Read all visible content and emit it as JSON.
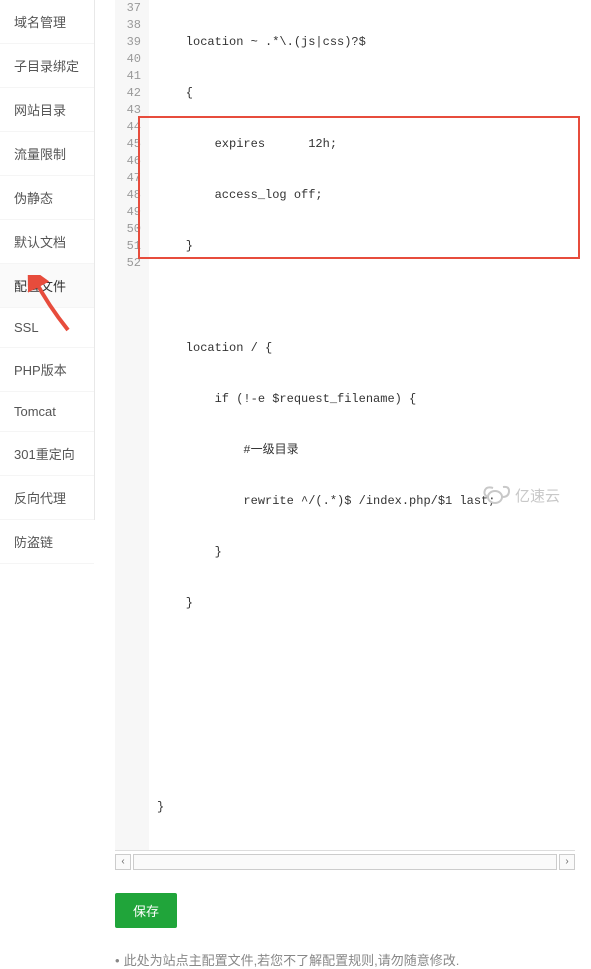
{
  "sidebar": {
    "items": [
      {
        "label": "域名管理"
      },
      {
        "label": "子目录绑定"
      },
      {
        "label": "网站目录"
      },
      {
        "label": "流量限制"
      },
      {
        "label": "伪静态"
      },
      {
        "label": "默认文档"
      },
      {
        "label": "配置文件"
      },
      {
        "label": "SSL"
      },
      {
        "label": "PHP版本"
      },
      {
        "label": "Tomcat"
      },
      {
        "label": "301重定向"
      },
      {
        "label": "反向代理"
      },
      {
        "label": "防盗链"
      }
    ],
    "active_index": 6
  },
  "editor": {
    "lines": [
      {
        "num": 37,
        "text": "    location ~ .*\\.(js|css)?$"
      },
      {
        "num": 38,
        "text": "    {"
      },
      {
        "num": 39,
        "text": "        expires      12h;"
      },
      {
        "num": 40,
        "text": "        access_log off;"
      },
      {
        "num": 41,
        "text": "    }"
      },
      {
        "num": 42,
        "text": ""
      },
      {
        "num": 43,
        "text": "    location / {"
      },
      {
        "num": 44,
        "text": "        if (!-e $request_filename) {"
      },
      {
        "num": 45,
        "text": "            #一级目录"
      },
      {
        "num": 46,
        "text": "            rewrite ^/(.*)$ /index.php/$1 last;"
      },
      {
        "num": 47,
        "text": "        }"
      },
      {
        "num": 48,
        "text": "    }"
      },
      {
        "num": 49,
        "text": ""
      },
      {
        "num": 50,
        "text": ""
      },
      {
        "num": 51,
        "text": ""
      },
      {
        "num": 52,
        "text": "}"
      }
    ]
  },
  "buttons": {
    "save": "保存"
  },
  "note": {
    "bullet": "•",
    "text": "此处为站点主配置文件,若您不了解配置规则,请勿随意修改."
  },
  "watermark": {
    "text": "亿速云"
  },
  "icons": {
    "scroll_left": "‹",
    "scroll_right": "›"
  }
}
